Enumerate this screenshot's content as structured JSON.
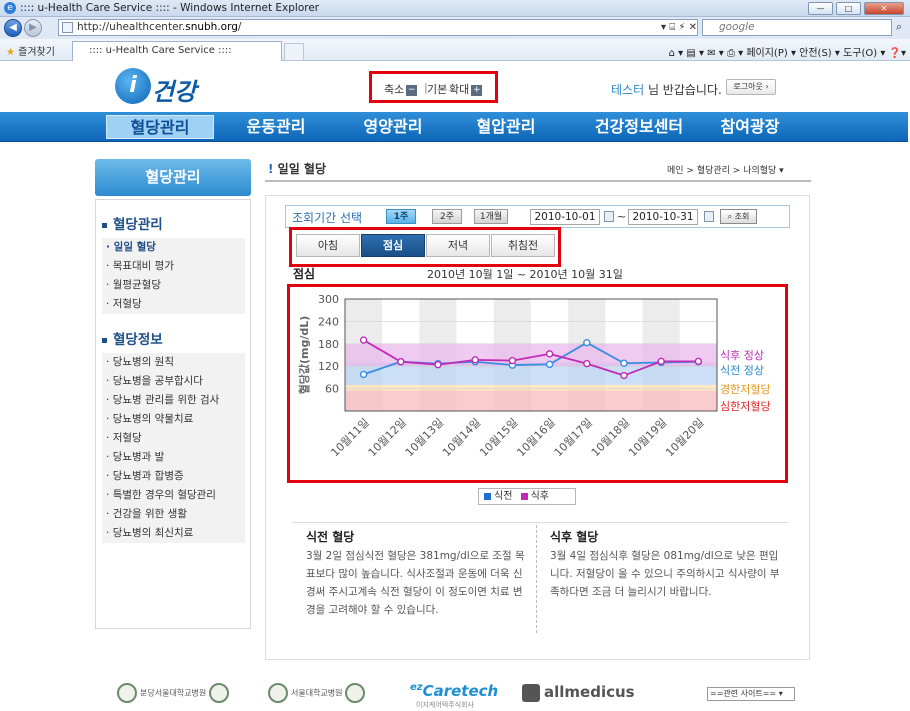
{
  "browser": {
    "title": ":::: u-Health Care Service :::: - Windows Internet Explorer",
    "url_prefix": "http://uhealthcenter.",
    "url_domain": "snubh.org",
    "url_suffix": "/",
    "search_placeholder": "google",
    "favorites_label": "즐겨찾기",
    "tab_label": ":::: u-Health Care Service ::::",
    "toolbar_right": "페이지(P) ▾  안전(S) ▾  도구(O) ▾"
  },
  "header": {
    "logo_text": "건강",
    "zoom_out": "축소",
    "zoom_default": "기본",
    "zoom_in": "확대",
    "user_name": "테스터",
    "greeting": "님 반갑습니다.",
    "logout": "로그아웃"
  },
  "gnb": [
    "혈당관리",
    "운동관리",
    "영양관리",
    "혈압관리",
    "건강정보센터",
    "참여광장"
  ],
  "sidebar": {
    "title": "혈당관리",
    "group1": "혈당관리",
    "items1": [
      "일일 혈당",
      "목표대비 평가",
      "월평균혈당",
      "저혈당"
    ],
    "group2": "혈당정보",
    "items2": [
      "당뇨병의 원칙",
      "당뇨병을 공부합시다",
      "당뇨병 관리를 위한 검사",
      "당뇨병의 약물치료",
      "저혈당",
      "당뇨병과 발",
      "당뇨병과 합병증",
      "특별한 경우의 혈당관리",
      "건강을 위한 생활",
      "당뇨병의 최신치료"
    ]
  },
  "content": {
    "title": "일일 혈당",
    "breadcrumb": "메인  >  혈당관리  >  나의혈당 ▾",
    "period_label": "조회기간 선택",
    "period_buttons": [
      "1주",
      "2주",
      "1개월"
    ],
    "date_from": "2010-10-01",
    "date_sep": "~",
    "date_to": "2010-10-31",
    "search_btn": "조회",
    "meal_tabs": [
      "아침",
      "점심",
      "저녁",
      "취침전"
    ],
    "chart_title": "점심",
    "chart_range": "2010년 10월 1일 ~ 2010년 10월 31일",
    "legend": [
      "식전",
      "식후"
    ],
    "note1_title": "식전 혈당",
    "note1_text": "3월 2일 점심식전 혈당은 381mg/dl으로 조절 목표보다 많이 높습니다. 식사조절과 운동에 더욱 신경써 주시고계속 식전 혈당이 이 정도이면 치료 변경을 고려해야 할 수 있습니다.",
    "note2_title": "식후 혈당",
    "note2_text": "3월 4일 점심식후 혈당은 081mg/dl으로 낮은 편입니다. 저혈당이 올 수 있으니 주의하시고 식사량이 부족하다면 조금 더 늘리시기 바랍니다."
  },
  "footer": {
    "logo1": "분당서울대학교병원",
    "logo2": "서울대학교병원",
    "logo3": "Caretech",
    "logo3_prefix": "ez",
    "logo3_sub": "이지케어텍주식회사",
    "logo4": "allmedicus",
    "related": "==관련 사이트== ▾"
  },
  "chart_data": {
    "type": "line",
    "title": "점심",
    "ylabel": "혈당값(mg/dL)",
    "ylim": [
      0,
      300
    ],
    "yticks": [
      60,
      120,
      180,
      240,
      300
    ],
    "categories": [
      "10월11일",
      "10월12일",
      "10월13일",
      "10월14일",
      "10월15일",
      "10월16일",
      "10월17일",
      "10월18일",
      "10월19일",
      "10월20일"
    ],
    "series": [
      {
        "name": "식전",
        "color": "#3a8ee0",
        "values": [
          98,
          132,
          127,
          132,
          123,
          125,
          183,
          128,
          130,
          132
        ]
      },
      {
        "name": "식후",
        "color": "#c02bb5",
        "values": [
          190,
          132,
          124,
          137,
          135,
          153,
          127,
          95,
          133,
          133
        ]
      }
    ],
    "bands": [
      {
        "name": "식후 정상",
        "from": 120,
        "to": 180,
        "color": "#e9b8ec",
        "label_color": "#c02bb5"
      },
      {
        "name": "식전 정상",
        "from": 70,
        "to": 130,
        "color": "#b9d6f3",
        "label_color": "#2b8ad0"
      },
      {
        "name": "경한저혈당",
        "from": 55,
        "to": 70,
        "color": "#fde3b0",
        "label_color": "#e8961a"
      },
      {
        "name": "심한저혈당",
        "from": 0,
        "to": 55,
        "color": "#f7bcbc",
        "label_color": "#e02424"
      }
    ]
  }
}
